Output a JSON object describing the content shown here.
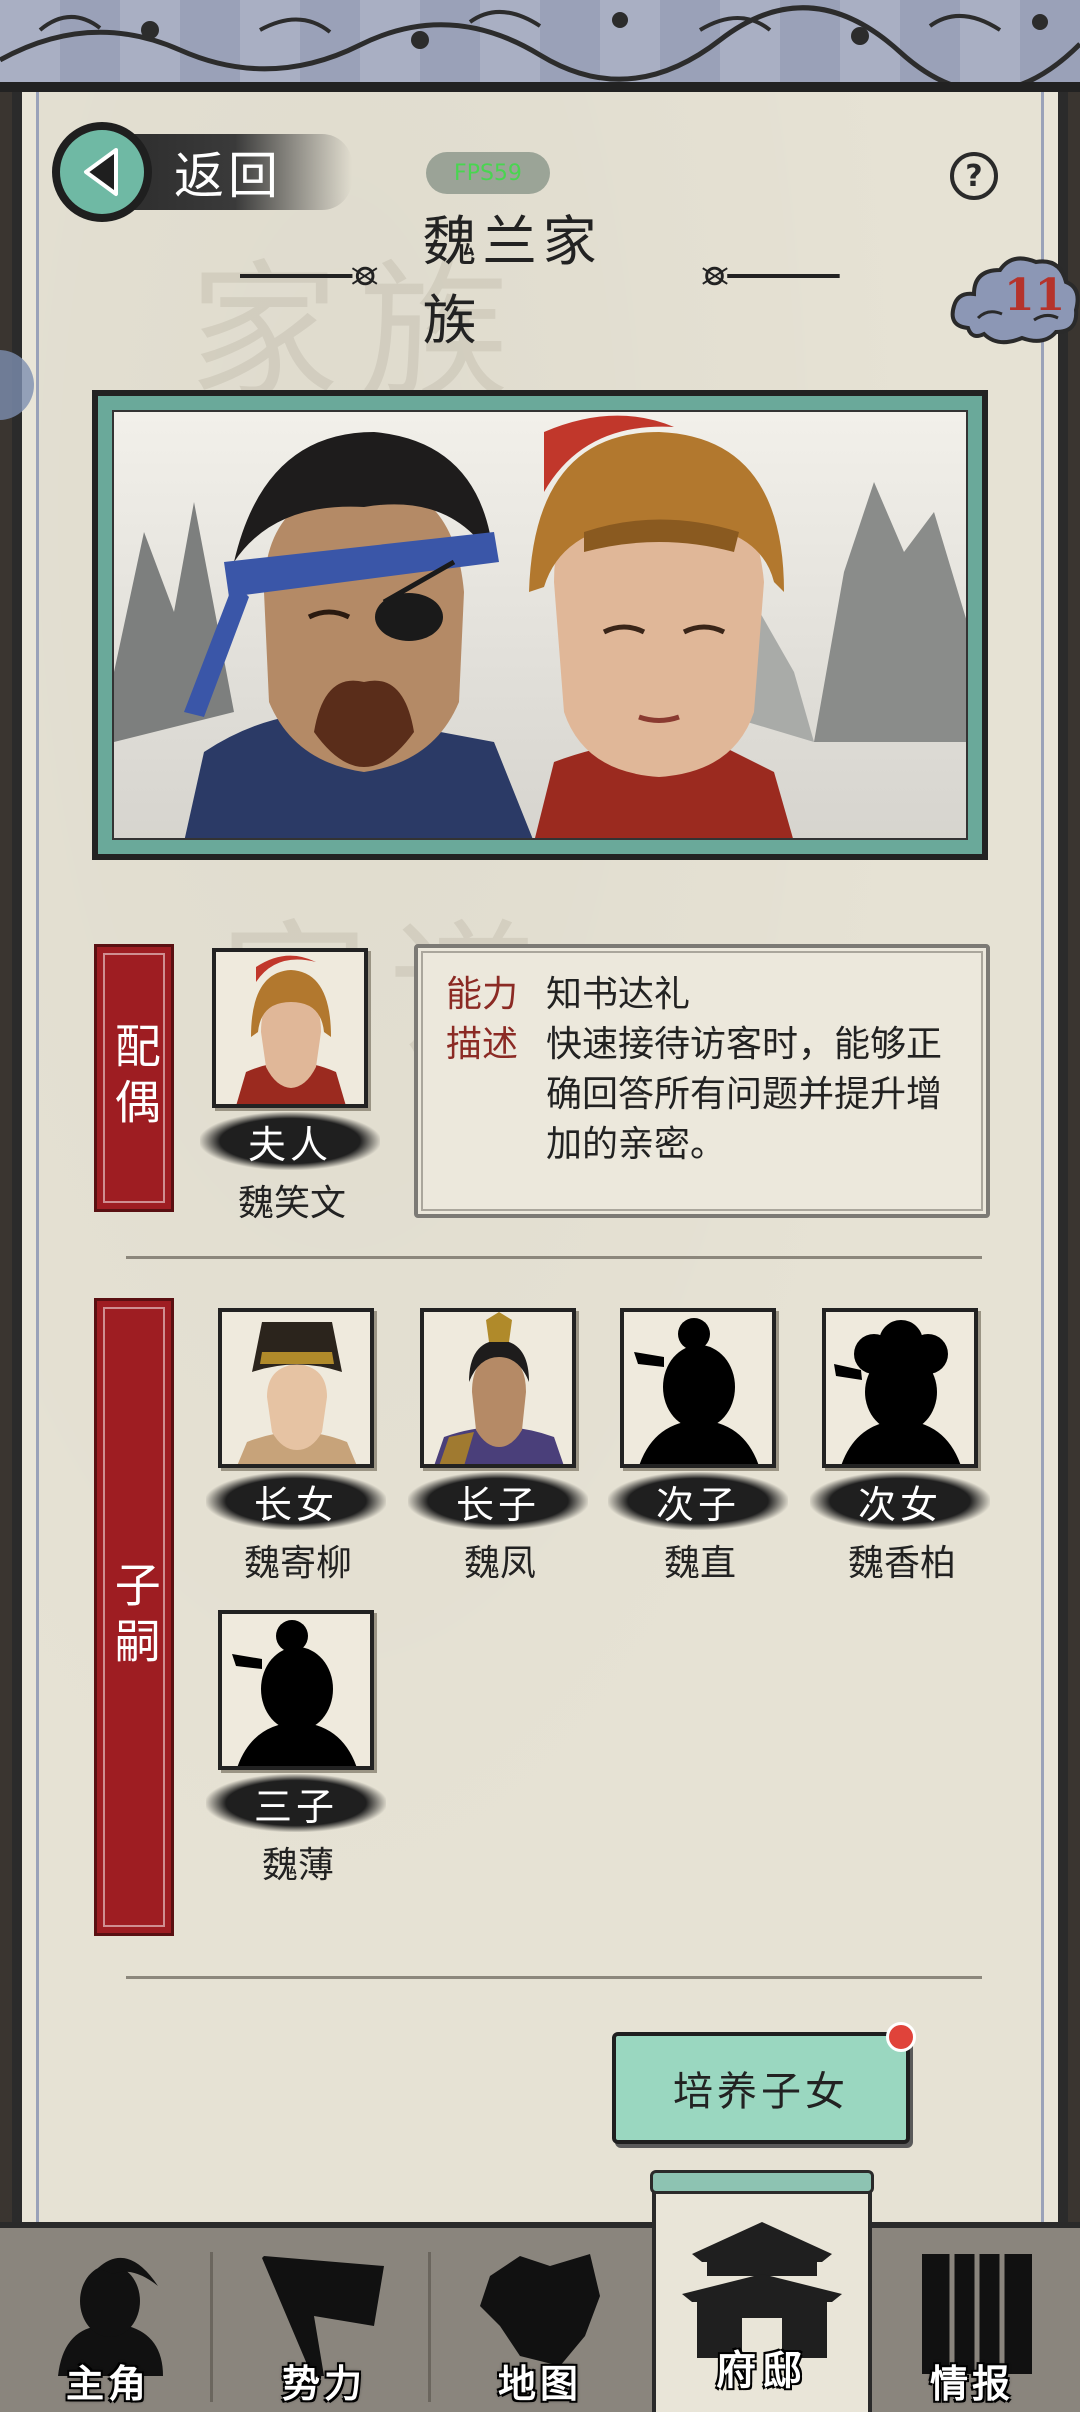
{
  "header": {
    "back_label": "返回",
    "fps_label": "FPS59",
    "help_icon": "?",
    "title": "魏兰家族",
    "badge_count": "11"
  },
  "spouse_section": {
    "label": "配偶",
    "role": "夫人",
    "name": "魏笑文",
    "ability_key": "能力",
    "ability_value": "知书达礼",
    "desc_key": "描述",
    "desc_value": "快速接待访客时，能够正确回答所有问题并提升增加的亲密。"
  },
  "children_section": {
    "label": "子嗣",
    "children": [
      {
        "role": "长女",
        "name": "魏寄柳",
        "portrait": "lady-portrait-icon"
      },
      {
        "role": "长子",
        "name": "魏凤",
        "portrait": "young-man-portrait-icon"
      },
      {
        "role": "次子",
        "name": "魏直",
        "portrait": "silhouette-boy-icon"
      },
      {
        "role": "次女",
        "name": "魏香柏",
        "portrait": "silhouette-girl-icon"
      },
      {
        "role": "三子",
        "name": "魏薄",
        "portrait": "silhouette-boy-icon"
      }
    ]
  },
  "action": {
    "nurture_label": "培养子女"
  },
  "nav": {
    "items": [
      {
        "label": "主角",
        "icon": "hero-icon"
      },
      {
        "label": "势力",
        "icon": "flag-icon"
      },
      {
        "label": "地图",
        "icon": "map-icon"
      },
      {
        "label": "府邸",
        "icon": "mansion-icon"
      },
      {
        "label": "情报",
        "icon": "scroll-icon"
      }
    ],
    "active": "府邸"
  },
  "colors": {
    "accent_teal": "#9ad7c0",
    "section_red": "#9e1d22",
    "paper": "#e6e2d4"
  }
}
